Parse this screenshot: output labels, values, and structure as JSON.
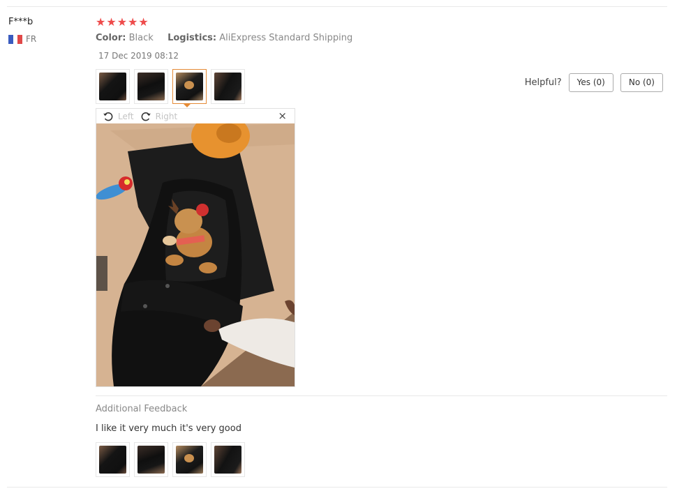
{
  "reviewer": {
    "name": "F***b",
    "country": "FR",
    "flag_colors": [
      "#3a5bbf",
      "#ffffff",
      "#e04848"
    ]
  },
  "review": {
    "rating": 5,
    "star_color": "#ee4b4b",
    "attributes": [
      {
        "key": "Color:",
        "value": "Black"
      },
      {
        "key": "Logistics:",
        "value": "AliExpress Standard Shipping"
      }
    ],
    "date": "17 Dec 2019 08:12"
  },
  "helpful": {
    "label": "Helpful?",
    "yes_label": "Yes (0)",
    "no_label": "No (0)"
  },
  "viewer": {
    "rotate_left_label": "Left",
    "rotate_right_label": "Right",
    "close_icon": "×",
    "active_thumb_index": 2,
    "active_color": "#e58b36"
  },
  "additional_feedback": {
    "title": "Additional Feedback",
    "text": "I like it very much it's very good"
  }
}
